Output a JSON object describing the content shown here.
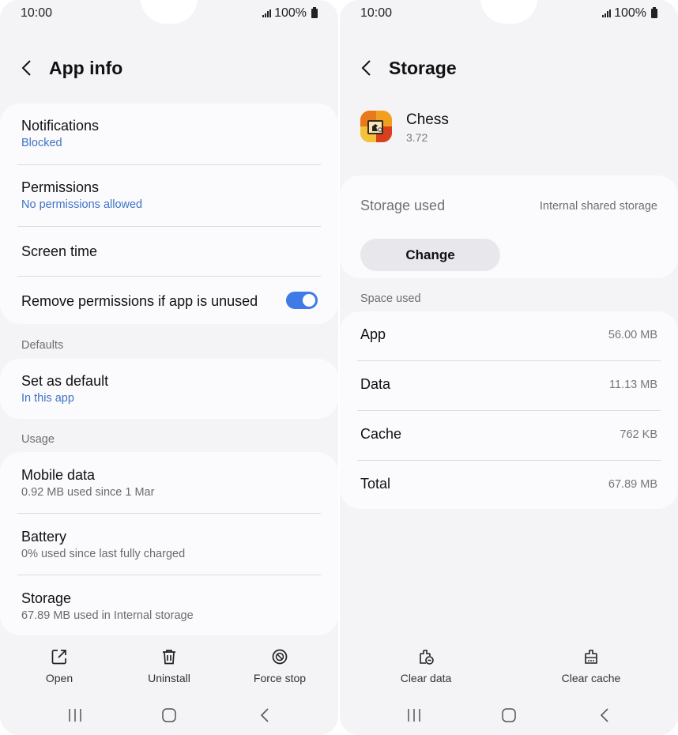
{
  "left": {
    "status": {
      "time": "10:00",
      "battery": "100%"
    },
    "header": {
      "title": "App info"
    },
    "group1": {
      "notifications": {
        "label": "Notifications",
        "sub": "Blocked"
      },
      "permissions": {
        "label": "Permissions",
        "sub": "No permissions allowed"
      },
      "screen_time": {
        "label": "Screen time"
      },
      "remove_permissions": {
        "label": "Remove permissions if app is unused",
        "enabled": true
      }
    },
    "defaults": {
      "section": "Defaults",
      "set_default": {
        "label": "Set as default",
        "sub": "In this app"
      }
    },
    "usage": {
      "section": "Usage",
      "mobile_data": {
        "label": "Mobile data",
        "sub": "0.92 MB used since 1 Mar"
      },
      "battery": {
        "label": "Battery",
        "sub": "0% used since last fully charged"
      },
      "storage": {
        "label": "Storage",
        "sub": "67.89 MB used in Internal storage"
      }
    },
    "actions": {
      "open": "Open",
      "uninstall": "Uninstall",
      "force_stop": "Force stop"
    }
  },
  "right": {
    "status": {
      "time": "10:00",
      "battery": "100%"
    },
    "header": {
      "title": "Storage"
    },
    "app": {
      "name": "Chess",
      "version": "3.72"
    },
    "storage_used": {
      "label": "Storage used",
      "location": "Internal shared storage",
      "change": "Change"
    },
    "space_used": {
      "section": "Space used",
      "rows": [
        {
          "label": "App",
          "value": "56.00 MB"
        },
        {
          "label": "Data",
          "value": "11.13 MB"
        },
        {
          "label": "Cache",
          "value": "762 KB"
        },
        {
          "label": "Total",
          "value": "67.89 MB"
        }
      ]
    },
    "actions": {
      "clear_data": "Clear data",
      "clear_cache": "Clear cache"
    }
  },
  "colors": {
    "accent": "#3e7be6",
    "link": "#3e72c6",
    "background": "#f4f4f7",
    "card": "#fbfbfd"
  }
}
